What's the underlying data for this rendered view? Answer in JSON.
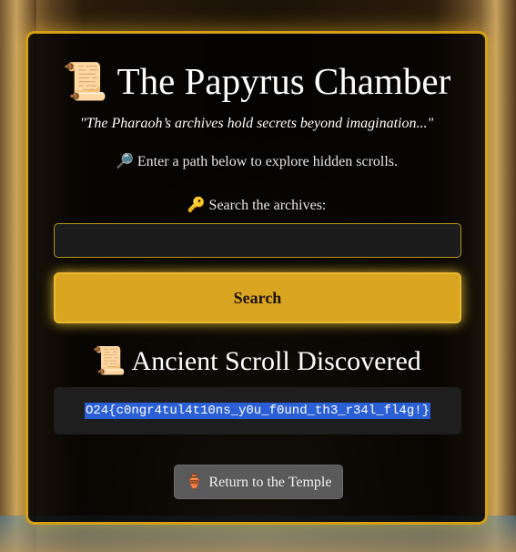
{
  "header": {
    "title_icon": "📜",
    "title": "The Papyrus Chamber",
    "subtitle": "\"The Pharaoh’s archives hold secrets beyond imagination...\""
  },
  "instructions": {
    "icon": "🔎",
    "text": "Enter a path below to explore hidden scrolls."
  },
  "search": {
    "label_icon": "🔑",
    "label": "Search the archives:",
    "value": "",
    "placeholder": "",
    "button_label": "Search"
  },
  "result": {
    "heading_icon": "📜",
    "heading": "Ancient Scroll Discovered",
    "flag": "O24{c0ngr4tul4t10ns_y0u_f0und_th3_r34l_fl4g!}"
  },
  "footer": {
    "return_icon": "🏺",
    "return_label": "Return to the Temple"
  },
  "colors": {
    "accent_gold": "#daa520",
    "panel_bg": "#000000",
    "selection_blue": "#2a5fd6"
  },
  "icons": {
    "title": "scroll-icon",
    "instructions": "magnifier-icon",
    "search_label": "key-icon",
    "result": "scroll-icon",
    "return": "amphora-icon"
  }
}
